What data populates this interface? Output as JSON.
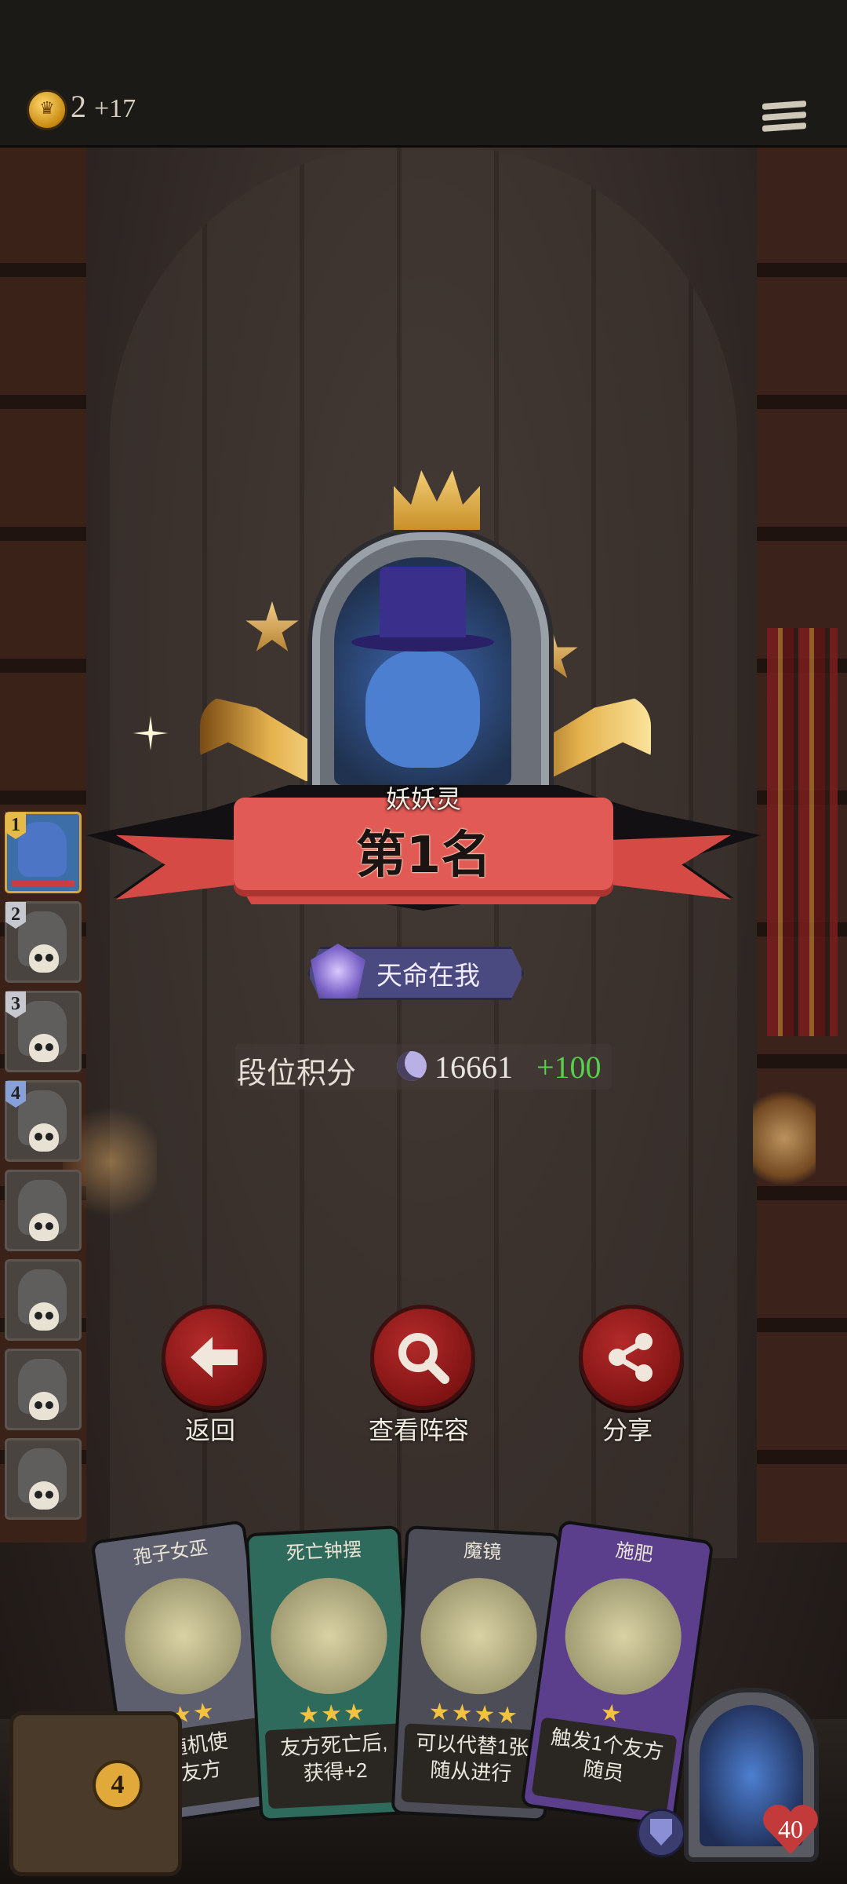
{
  "topbar": {
    "gold": "2",
    "gold_bonus": "+17",
    "coin_icon": "crown-coin-icon",
    "menu_icon": "hamburger-menu-icon"
  },
  "rankings": [
    {
      "rank": "1",
      "status": "alive"
    },
    {
      "rank": "2",
      "status": "dead"
    },
    {
      "rank": "3",
      "status": "dead"
    },
    {
      "rank": "4",
      "status": "dead"
    },
    {
      "rank": "",
      "status": "dead"
    },
    {
      "rank": "",
      "status": "dead"
    },
    {
      "rank": "",
      "status": "dead"
    },
    {
      "rank": "",
      "status": "dead"
    }
  ],
  "result": {
    "hero_name": "妖妖灵",
    "rank_title": "第1名",
    "achievement": "天命在我",
    "score_label": "段位积分",
    "score_value": "16661",
    "score_change": "+100"
  },
  "actions": [
    {
      "label": "返回",
      "icon": "arrow-left-icon"
    },
    {
      "label": "查看阵容",
      "icon": "magnifier-icon"
    },
    {
      "label": "分享",
      "icon": "share-icon"
    }
  ],
  "cards": [
    {
      "name": "孢子女巫",
      "stars": "★★",
      "desc_line1": "随机使",
      "desc_line2": "友方",
      "color": "#5d5f6e"
    },
    {
      "name": "死亡钟摆",
      "stars": "★★★",
      "desc_line1": "友方死亡后,",
      "desc_line2": "获得+2",
      "color": "#2f6b5c"
    },
    {
      "name": "魔镜",
      "stars": "★★★★",
      "desc_line1": "可以代替1张",
      "desc_line2": "随从进行",
      "color": "#4c4d57"
    },
    {
      "name": "施肥",
      "stars": "★",
      "desc_line1": "触发1个友方",
      "desc_line2": "随员",
      "color": "#5b3f8c"
    }
  ],
  "bottom": {
    "tavern_level": "4",
    "hero_health": "40"
  }
}
